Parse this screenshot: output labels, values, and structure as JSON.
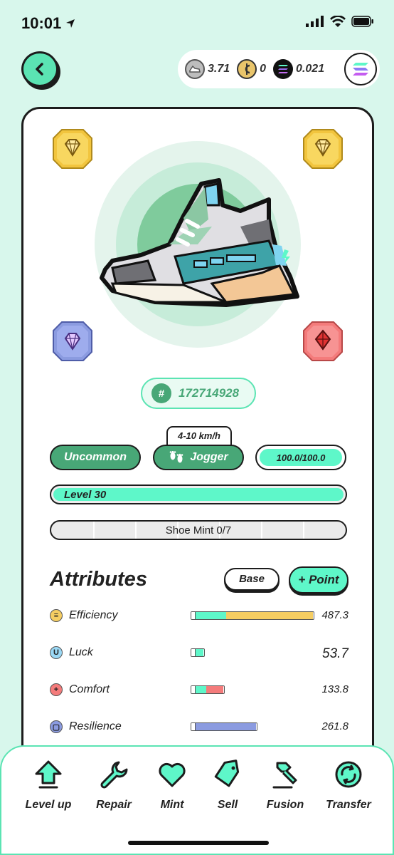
{
  "status": {
    "time": "10:01"
  },
  "wallet": {
    "coins": [
      {
        "name": "GST",
        "value": "3.71",
        "icon": "sneaker-coin-icon"
      },
      {
        "name": "GMT",
        "value": "0",
        "icon": "gmt-coin-icon"
      },
      {
        "name": "SOL",
        "value": "0.021",
        "icon": "solana-coin-icon"
      }
    ]
  },
  "sneaker": {
    "id": "172714928",
    "id_prefix": "#",
    "rarity": "Uncommon",
    "type": "Jogger",
    "speed_range": "4-10 km/h",
    "durability": "100.0/100.0",
    "durability_fraction": 1.0,
    "level_text": "Level 30",
    "level_fraction": 1.0,
    "mint_text": "Shoe Mint 0/7",
    "gems": [
      "yellow-gem-icon",
      "yellow-gem-icon",
      "purple-gem-icon",
      "red-gem-icon"
    ]
  },
  "attributes": {
    "title": "Attributes",
    "base_label": "Base",
    "point_label": "+ Point",
    "rows": [
      {
        "name": "Efficiency",
        "value": "487.3",
        "base_fraction": 0.26,
        "bonus_fraction": 0.74,
        "bonus_color": "#f5cd62",
        "icon_color": "#f5cd62",
        "glyph": "≡"
      },
      {
        "name": "Luck",
        "value": "53.7",
        "base_fraction": 1.0,
        "bonus_fraction": 0.0,
        "bonus_color": "#7fd4f0",
        "icon_color": "#9ad8f5",
        "glyph": "U"
      },
      {
        "name": "Comfort",
        "value": "133.8",
        "base_fraction": 0.38,
        "bonus_fraction": 0.62,
        "bonus_color": "#f47b7b",
        "icon_color": "#f47b7b",
        "glyph": "+"
      },
      {
        "name": "Resilience",
        "value": "261.8",
        "base_fraction": 0.0,
        "bonus_fraction": 1.0,
        "bonus_color": "#8b9be0",
        "icon_color": "#8b9be0",
        "glyph": "▢"
      }
    ]
  },
  "actions": [
    {
      "label": "Level up",
      "icon": "arrow-up-icon"
    },
    {
      "label": "Repair",
      "icon": "wrench-icon"
    },
    {
      "label": "Mint",
      "icon": "heart-icon"
    },
    {
      "label": "Sell",
      "icon": "tag-icon"
    },
    {
      "label": "Fusion",
      "icon": "hammer-icon"
    },
    {
      "label": "Transfer",
      "icon": "transfer-icon"
    }
  ],
  "colors": {
    "accent": "#5be4b3",
    "green": "#48a777",
    "mint": "#5ef7c9",
    "bg": "#d8f7ec"
  }
}
